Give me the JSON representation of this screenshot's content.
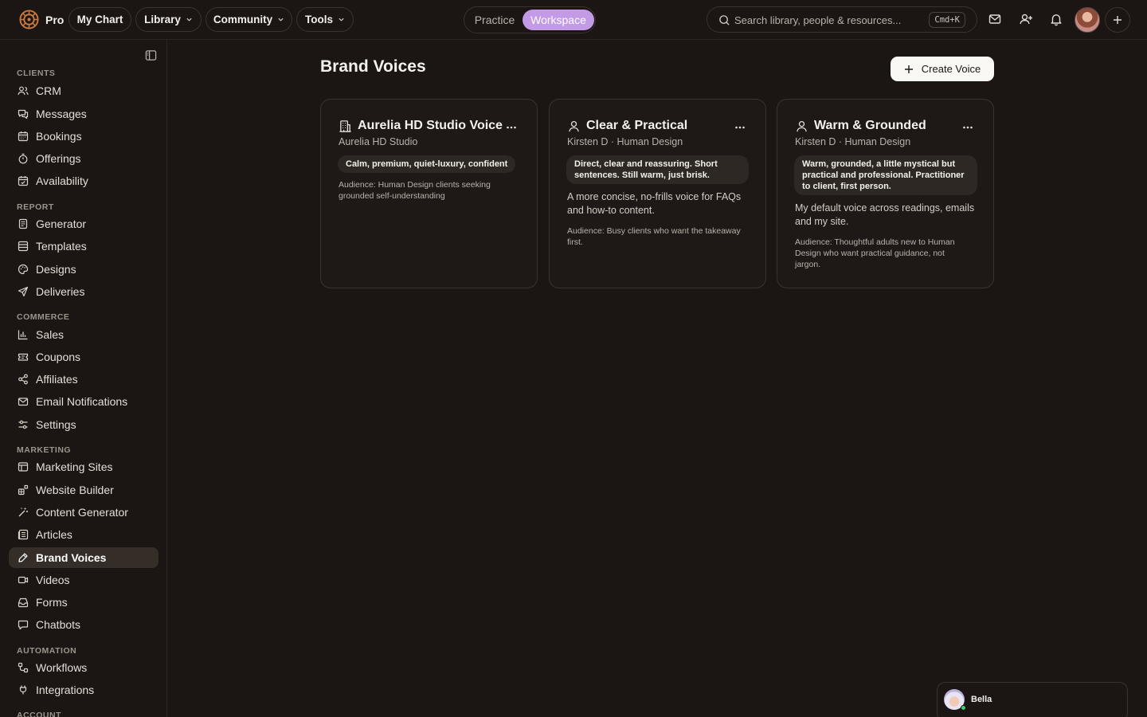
{
  "topbar": {
    "brand": "Pro",
    "nav": [
      {
        "label": "My Chart"
      },
      {
        "label": "Library"
      },
      {
        "label": "Community"
      },
      {
        "label": "Tools"
      }
    ],
    "mode_toggle": {
      "practice": "Practice",
      "workspace": "Workspace",
      "selected": "Workspace"
    },
    "search": {
      "placeholder": "Search library, people & resources...",
      "shortcut": "Cmd+K"
    },
    "icons": [
      "mail-icon",
      "user-plus-icon",
      "bell-icon",
      "avatar",
      "plus-icon"
    ]
  },
  "sidebar": {
    "sections": [
      {
        "label": "CLIENTS",
        "items": [
          "CRM",
          "Messages",
          "Bookings",
          "Offerings",
          "Availability"
        ]
      },
      {
        "label": "REPORT",
        "items": [
          "Generator",
          "Templates",
          "Designs",
          "Deliveries"
        ]
      },
      {
        "label": "COMMERCE",
        "items": [
          "Sales",
          "Coupons",
          "Affiliates",
          "Email Notifications",
          "Settings"
        ]
      },
      {
        "label": "MARKETING",
        "items": [
          "Marketing Sites",
          "Website Builder",
          "Content Generator",
          "Articles",
          "Brand Voices",
          "Videos",
          "Forms",
          "Chatbots"
        ]
      },
      {
        "label": "AUTOMATION",
        "items": [
          "Workflows",
          "Integrations"
        ]
      },
      {
        "label": "ACCOUNT",
        "items": []
      }
    ],
    "active_item": "Brand Voices"
  },
  "main": {
    "title": "Brand Voices",
    "create_button": "Create Voice",
    "cards": [
      {
        "icon": "building-icon",
        "title": "Aurelia HD Studio Voice",
        "subtitle": "Aurelia HD Studio",
        "tone": "Calm, premium, quiet-luxury, confident",
        "description": "",
        "audience": "Audience: Human Design clients seeking grounded self-understanding"
      },
      {
        "icon": "user-icon",
        "title": "Clear & Practical",
        "subtitle": "Kirsten D · Human Design",
        "tone": "Direct, clear and reassuring. Short sentences. Still warm, just brisk.",
        "description": "A more concise, no-frills voice for FAQs and how-to content.",
        "audience": "Audience: Busy clients who want the takeaway first."
      },
      {
        "icon": "user-icon",
        "title": "Warm & Grounded",
        "subtitle": "Kirsten D · Human Design",
        "tone": "Warm, grounded, a little mystical but practical and professional. Practitioner to client, first person.",
        "description": "My default voice across readings, emails and my site.",
        "audience": "Audience: Thoughtful adults new to Human Design who want practical guidance, not jargon."
      }
    ]
  },
  "chat": {
    "name": "Bella",
    "status_color": "#3fcf6a"
  },
  "colors": {
    "accent": "#c39ae6",
    "background": "#1b1613",
    "card_border": "#3a332d"
  }
}
